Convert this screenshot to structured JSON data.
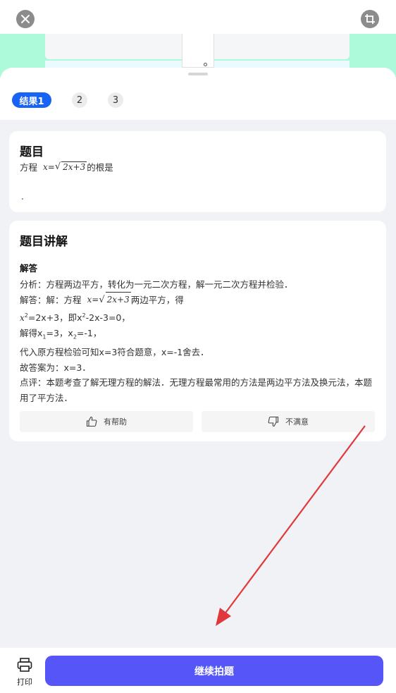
{
  "results": {
    "tabs": [
      {
        "label": "结果1",
        "active": true
      },
      {
        "label": "2",
        "active": false
      },
      {
        "label": "3",
        "active": false
      }
    ]
  },
  "question": {
    "title": "题目",
    "prefix": "方程",
    "eq_lhs": "x=",
    "eq_radicand": "2x+3",
    "suffix": "的根是",
    "trailing": "."
  },
  "explanation": {
    "title": "题目讲解",
    "subtitle": "解答",
    "line1": "分析：方程两边平方，转化为一元二次方程，解一元二次方程并检验．",
    "line2_prefix": "解答：解：方程",
    "line2_lhs": "x=",
    "line2_radicand": "2x+3",
    "line2_suffix": "两边平方，得",
    "line3_a": "x",
    "line3_b": "=2x+3，即x",
    "line3_c": "-2x-3=0，",
    "line4_a": "解得x",
    "line4_b": "=3，x",
    "line4_c": "=-1，",
    "line5": "代入原方程检验可知x=3符合题意，x=-1舍去．",
    "line6": "故答案为：x=3．",
    "line7": "点评：本题考查了解无理方程的解法．无理方程最常用的方法是两边平方法及换元法，本题用了平方法．"
  },
  "feedback": {
    "helpful_label": "有帮助",
    "unsatisfied_label": "不满意"
  },
  "bottom": {
    "print_label": "打印",
    "continue_label": "继续拍题"
  },
  "icons": {
    "close": "close-icon",
    "crop": "crop-icon",
    "thumb_up": "thumbs-up-icon",
    "thumb_down": "thumbs-down-icon",
    "print": "printer-icon"
  },
  "colors": {
    "accent": "#1763f5",
    "continue_button": "#5656f8",
    "photo_background": "#adfadb",
    "annotation_arrow": "#e0383c"
  }
}
